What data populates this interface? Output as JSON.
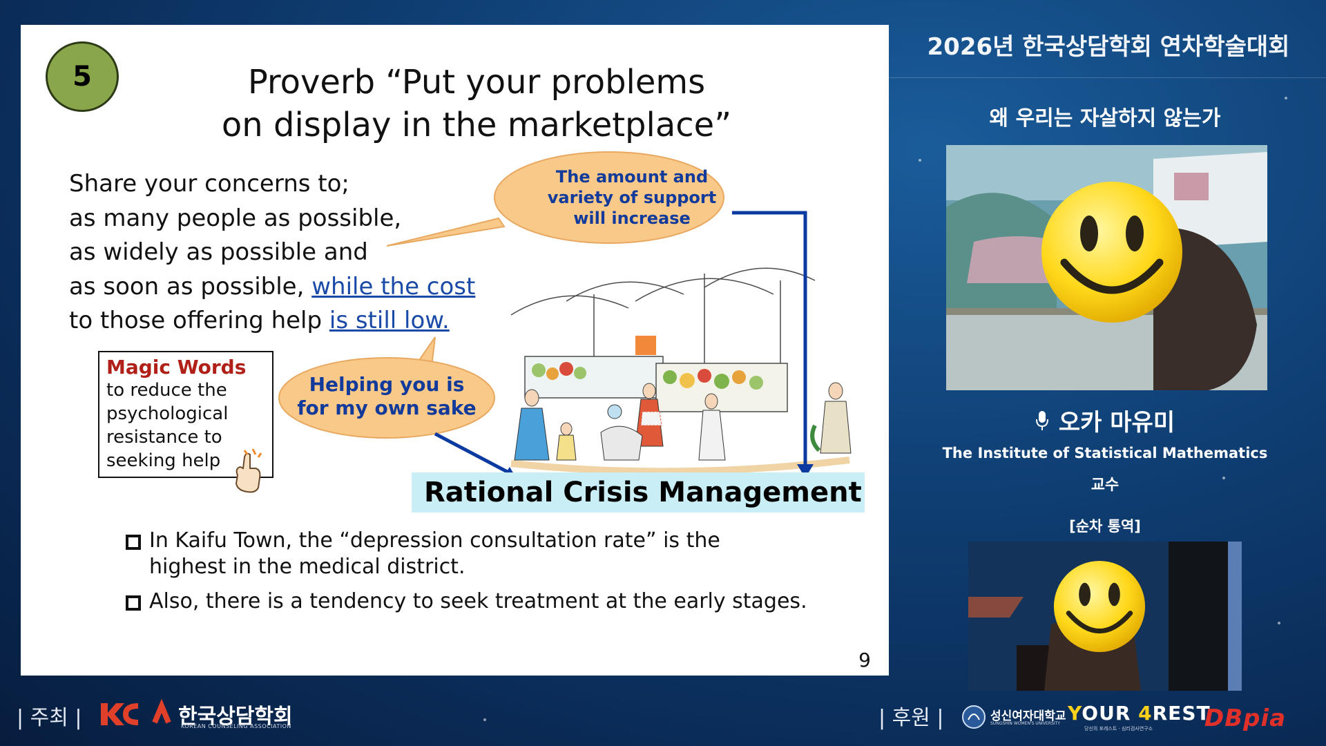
{
  "slide": {
    "badge": "5",
    "title_line1": "Proverb “Put your problems",
    "title_line2": "on display in the marketplace”",
    "body": {
      "line1": "Share your concerns to;",
      "line2": "as many people as possible,",
      "line3": "as widely as possible and",
      "line4_prefix": "as soon as possible, ",
      "line4_link": "while the cost",
      "line5_prefix": "to those offering help ",
      "line5_link": "is still low."
    },
    "bubble1": {
      "line1": "The amount and",
      "line2": "variety of support",
      "line3": "will increase"
    },
    "bubble2": {
      "line1": "Helping you is",
      "line2": "for my own sake"
    },
    "magic_box": {
      "title": "Magic Words",
      "line1": "to reduce the",
      "line2": "psychological",
      "line3": "resistance to",
      "line4": "seeking help"
    },
    "highlight": "Rational Crisis Management",
    "bullets": [
      {
        "line1": "In Kaifu Town, the “depression consultation rate” is the",
        "line2": "highest in the medical district."
      },
      {
        "line1": "Also, there is a tendency to seek treatment at the early stages.",
        "line2": ""
      }
    ],
    "page_number": "9",
    "colors": {
      "badge": "#8aa64a",
      "bubble": "#f9c98a",
      "link": "#1a4aa8",
      "magic_title": "#b02018",
      "highlight_bg": "#c9eef5",
      "arrow": "#0b3aa0"
    }
  },
  "panel": {
    "conference_title": "2026년 한국상담학회 연차학술대회",
    "lecture_title": "왜 우리는 자살하지 않는가",
    "speaker_name": "오카 마유미",
    "speaker_affiliation": "The Institute of Statistical Mathematics",
    "speaker_role": "교수",
    "interpretation_label": "[순차 통역]",
    "icons": [
      "microphone-icon",
      "smiley-face-icon"
    ]
  },
  "footer": {
    "host_label": "| 주최 |",
    "host_name": "한국상담학회",
    "host_sub": "KOREAN COUNSELING ASSOCIATION",
    "sponsor_label": "| 후원 |",
    "sponsor1": "성신여자대학교",
    "sponsor1_sub": "SUNGSHIN WOMEN'S UNIVERSITY",
    "sponsor2_a": "Y",
    "sponsor2_b": "OUR ",
    "sponsor2_c": "4",
    "sponsor2_d": "REST",
    "sponsor2_sub": "당신의 포레스트 · 심리검사연구소",
    "sponsor3": "DBpia"
  }
}
